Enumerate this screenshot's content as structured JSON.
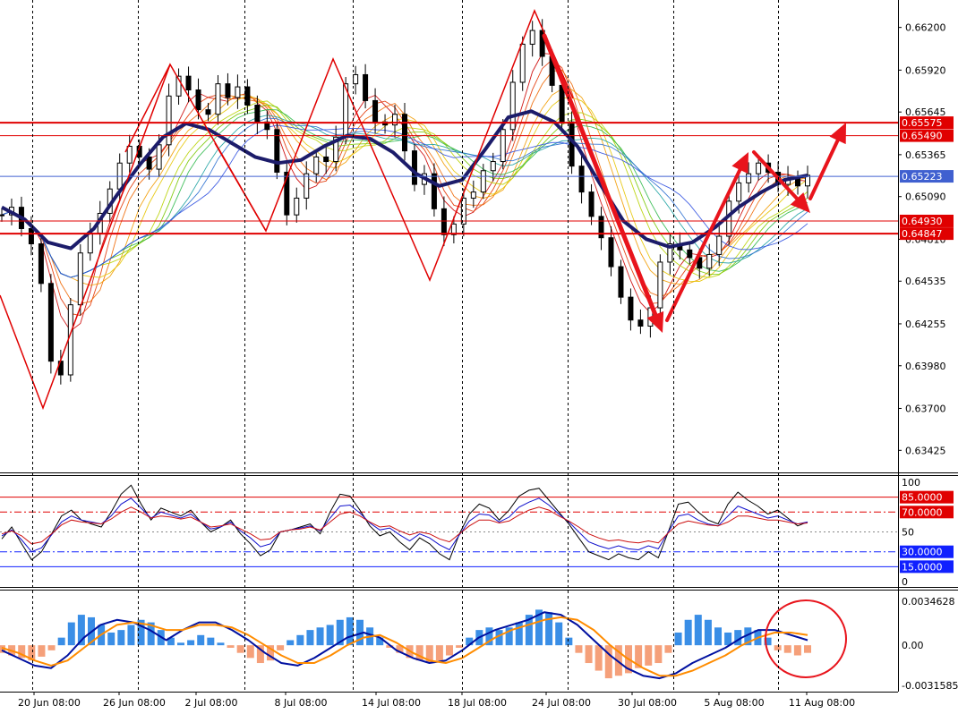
{
  "chart_data": [
    {
      "type": "candlestick",
      "panel": "price",
      "ylim": [
        0.6328,
        0.6638
      ],
      "y_ticks": [
        "0.66200",
        "0.65920",
        "0.65645",
        "0.65365",
        "0.65090",
        "0.64810",
        "0.64535",
        "0.64255",
        "0.63980",
        "0.63700",
        "0.63425"
      ],
      "current_price": "0.65223",
      "price_labels": [
        {
          "text": "0.65575",
          "y": 0.65575,
          "color": "#e00000",
          "weight": "thick"
        },
        {
          "text": "0.65490",
          "y": 0.6549,
          "color": "#e00000",
          "weight": "thin"
        },
        {
          "text": "0.65223",
          "y": 0.65223,
          "color": "#4060d0",
          "weight": "current"
        },
        {
          "text": "0.64930",
          "y": 0.6493,
          "color": "#e00000",
          "weight": "thin"
        },
        {
          "text": "0.64847",
          "y": 0.64847,
          "color": "#e00000",
          "weight": "thick"
        }
      ],
      "x_labels": [
        "20 Jun 08:00",
        "26 Jun 08:00",
        "2 Jul 08:00",
        "8 Jul 08:00",
        "14 Jul 08:00",
        "18 Jul 08:00",
        "24 Jul 08:00",
        "30 Jul 08:00",
        "5 Aug 08:00",
        "11 Aug 08:00"
      ],
      "close_path": [
        0.6497,
        0.6502,
        0.6488,
        0.6478,
        0.6452,
        0.6401,
        0.6392,
        0.6438,
        0.6472,
        0.6485,
        0.6498,
        0.6514,
        0.6531,
        0.6542,
        0.6535,
        0.6527,
        0.6543,
        0.6575,
        0.6588,
        0.6579,
        0.6566,
        0.6563,
        0.6583,
        0.6574,
        0.6581,
        0.6569,
        0.6558,
        0.6553,
        0.6525,
        0.6497,
        0.6508,
        0.6524,
        0.6535,
        0.6532,
        0.6548,
        0.6583,
        0.6589,
        0.6572,
        0.6558,
        0.6556,
        0.6563,
        0.6539,
        0.6517,
        0.6524,
        0.6501,
        0.6484,
        0.6491,
        0.6508,
        0.6512,
        0.6526,
        0.6532,
        0.6553,
        0.6584,
        0.6609,
        0.6618,
        0.6601,
        0.6582,
        0.6558,
        0.6529,
        0.6512,
        0.6496,
        0.6482,
        0.6463,
        0.6443,
        0.6428,
        0.6424,
        0.6436,
        0.6466,
        0.6478,
        0.6474,
        0.6469,
        0.6462,
        0.6471,
        0.6483,
        0.6506,
        0.6518,
        0.6524,
        0.6531,
        0.6525,
        0.6517,
        0.6521,
        0.6516,
        0.6523
      ],
      "slow_ma_path": [
        0.6502,
        0.6494,
        0.6479,
        0.6475,
        0.6488,
        0.651,
        0.653,
        0.6548,
        0.6557,
        0.6553,
        0.6544,
        0.6535,
        0.6531,
        0.6533,
        0.6542,
        0.6549,
        0.6547,
        0.6538,
        0.6524,
        0.6516,
        0.652,
        0.654,
        0.6561,
        0.6565,
        0.6558,
        0.6542,
        0.6517,
        0.6493,
        0.6481,
        0.6476,
        0.6479,
        0.6489,
        0.6502,
        0.6512,
        0.652,
        0.6523
      ],
      "annotations": [
        "zigzag wave lines",
        "red arrows forecast",
        "moving average ribbon"
      ]
    },
    {
      "type": "line",
      "panel": "oscillator",
      "ylim": [
        0,
        100
      ],
      "y_ticks": [
        "100",
        "50",
        "0"
      ],
      "levels": [
        {
          "text": "85.0000",
          "value": 85,
          "color": "#e00000",
          "style": "solid"
        },
        {
          "text": "70.0000",
          "value": 70,
          "color": "#e00000",
          "style": "dashdot"
        },
        {
          "text": "30.0000",
          "value": 30,
          "color": "#1020ff",
          "style": "dashdot"
        },
        {
          "text": "15.0000",
          "value": 15,
          "color": "#1020ff",
          "style": "solid"
        }
      ],
      "series": [
        {
          "color": "#000000",
          "values": [
            43,
            55,
            38,
            22,
            30,
            48,
            66,
            72,
            62,
            58,
            55,
            70,
            88,
            97,
            78,
            62,
            74,
            70,
            66,
            72,
            60,
            50,
            55,
            62,
            48,
            38,
            26,
            32,
            50,
            52,
            55,
            58,
            48,
            70,
            88,
            86,
            72,
            56,
            46,
            50,
            40,
            32,
            44,
            38,
            28,
            22,
            48,
            68,
            78,
            74,
            62,
            72,
            86,
            92,
            94,
            82,
            70,
            58,
            44,
            30,
            26,
            22,
            28,
            24,
            22,
            30,
            24,
            50,
            78,
            80,
            70,
            62,
            58,
            78,
            90,
            82,
            76,
            68,
            72,
            64,
            56,
            60
          ]
        },
        {
          "color": "#1010cc",
          "values": [
            46,
            52,
            42,
            30,
            34,
            47,
            60,
            66,
            62,
            60,
            58,
            66,
            78,
            84,
            74,
            64,
            70,
            67,
            64,
            68,
            60,
            53,
            55,
            60,
            51,
            44,
            35,
            38,
            50,
            52,
            54,
            56,
            51,
            64,
            76,
            77,
            69,
            59,
            52,
            54,
            47,
            41,
            48,
            44,
            37,
            32,
            47,
            61,
            68,
            67,
            60,
            65,
            75,
            80,
            84,
            77,
            68,
            60,
            50,
            40,
            36,
            33,
            36,
            33,
            32,
            36,
            33,
            50,
            66,
            68,
            62,
            58,
            56,
            66,
            76,
            72,
            68,
            64,
            66,
            62,
            58,
            60
          ]
        },
        {
          "color": "#cc1010",
          "values": [
            48,
            51,
            46,
            38,
            40,
            48,
            57,
            62,
            60,
            59,
            58,
            63,
            70,
            75,
            70,
            64,
            66,
            65,
            63,
            65,
            60,
            55,
            56,
            58,
            53,
            48,
            42,
            43,
            50,
            52,
            53,
            55,
            52,
            60,
            68,
            70,
            66,
            60,
            55,
            56,
            51,
            47,
            50,
            48,
            43,
            40,
            48,
            56,
            62,
            62,
            59,
            61,
            67,
            72,
            75,
            72,
            66,
            61,
            55,
            48,
            44,
            41,
            42,
            40,
            39,
            41,
            39,
            49,
            58,
            61,
            59,
            57,
            56,
            60,
            66,
            66,
            64,
            62,
            62,
            60,
            58,
            59
          ]
        }
      ]
    },
    {
      "type": "bar+line",
      "panel": "macd",
      "ylim": [
        -0.0031585,
        0.0034628
      ],
      "y_ticks": [
        "0.0034628",
        "0.00",
        "-0.0031585"
      ],
      "histogram": [
        -0.0006,
        -0.0008,
        -0.001,
        -0.0012,
        -0.0009,
        -0.0004,
        0.0006,
        0.0018,
        0.0024,
        0.0022,
        0.0016,
        0.001,
        0.0012,
        0.0016,
        0.002,
        0.0018,
        0.0012,
        0.0006,
        0.0002,
        0.0004,
        0.0008,
        0.0006,
        0.0002,
        -0.0002,
        -0.0006,
        -0.001,
        -0.0014,
        -0.0012,
        -0.0004,
        0.0004,
        0.0008,
        0.0012,
        0.0014,
        0.0016,
        0.002,
        0.0022,
        0.002,
        0.0014,
        0.0006,
        -0.0002,
        -0.0006,
        -0.001,
        -0.0012,
        -0.0014,
        -0.0012,
        -0.0008,
        -0.0002,
        0.0006,
        0.0012,
        0.0014,
        0.0012,
        0.0014,
        0.0018,
        0.0024,
        0.0028,
        0.0026,
        0.0018,
        0.0006,
        -0.0006,
        -0.0014,
        -0.002,
        -0.0026,
        -0.0024,
        -0.0022,
        -0.0018,
        -0.0016,
        -0.0014,
        -0.0006,
        0.001,
        0.002,
        0.0024,
        0.002,
        0.0014,
        0.001,
        0.0012,
        0.0014,
        0.0012,
        0.0006,
        -0.0004,
        -0.0006,
        -0.0008,
        -0.0006
      ],
      "series": [
        {
          "color": "#0010a0",
          "values": [
            -0.0004,
            -0.001,
            -0.0016,
            -0.0018,
            -0.0008,
            0.0006,
            0.0016,
            0.002,
            0.0018,
            0.0012,
            0.0004,
            0.0012,
            0.0018,
            0.0018,
            0.0012,
            0.0004,
            -0.0006,
            -0.0014,
            -0.0016,
            -0.001,
            -0.0002,
            0.0006,
            0.001,
            0.0006,
            -0.0004,
            -0.001,
            -0.0014,
            -0.0012,
            -0.0004,
            0.0006,
            0.0012,
            0.0016,
            0.002,
            0.0026,
            0.0024,
            0.0016,
            0.0004,
            -0.0008,
            -0.0018,
            -0.0024,
            -0.0026,
            -0.0022,
            -0.0014,
            -0.0008,
            -0.0002,
            0.0006,
            0.0012,
            0.0012,
            0.0008,
            0.0004
          ]
        },
        {
          "color": "#ff8c00",
          "values": [
            -0.0002,
            -0.0006,
            -0.0012,
            -0.0016,
            -0.0012,
            -0.0002,
            0.0008,
            0.0016,
            0.0018,
            0.0016,
            0.0012,
            0.0012,
            0.0016,
            0.0016,
            0.0014,
            0.0008,
            0.0,
            -0.0008,
            -0.0014,
            -0.0014,
            -0.0008,
            0.0,
            0.0006,
            0.0008,
            0.0002,
            -0.0006,
            -0.0012,
            -0.0014,
            -0.001,
            -0.0002,
            0.0006,
            0.0012,
            0.0016,
            0.002,
            0.0022,
            0.002,
            0.0012,
            0.0,
            -0.001,
            -0.0018,
            -0.0024,
            -0.0024,
            -0.002,
            -0.0014,
            -0.0008,
            0.0,
            0.0006,
            0.001,
            0.001,
            0.0008
          ]
        }
      ],
      "annotation": "red circle"
    }
  ]
}
